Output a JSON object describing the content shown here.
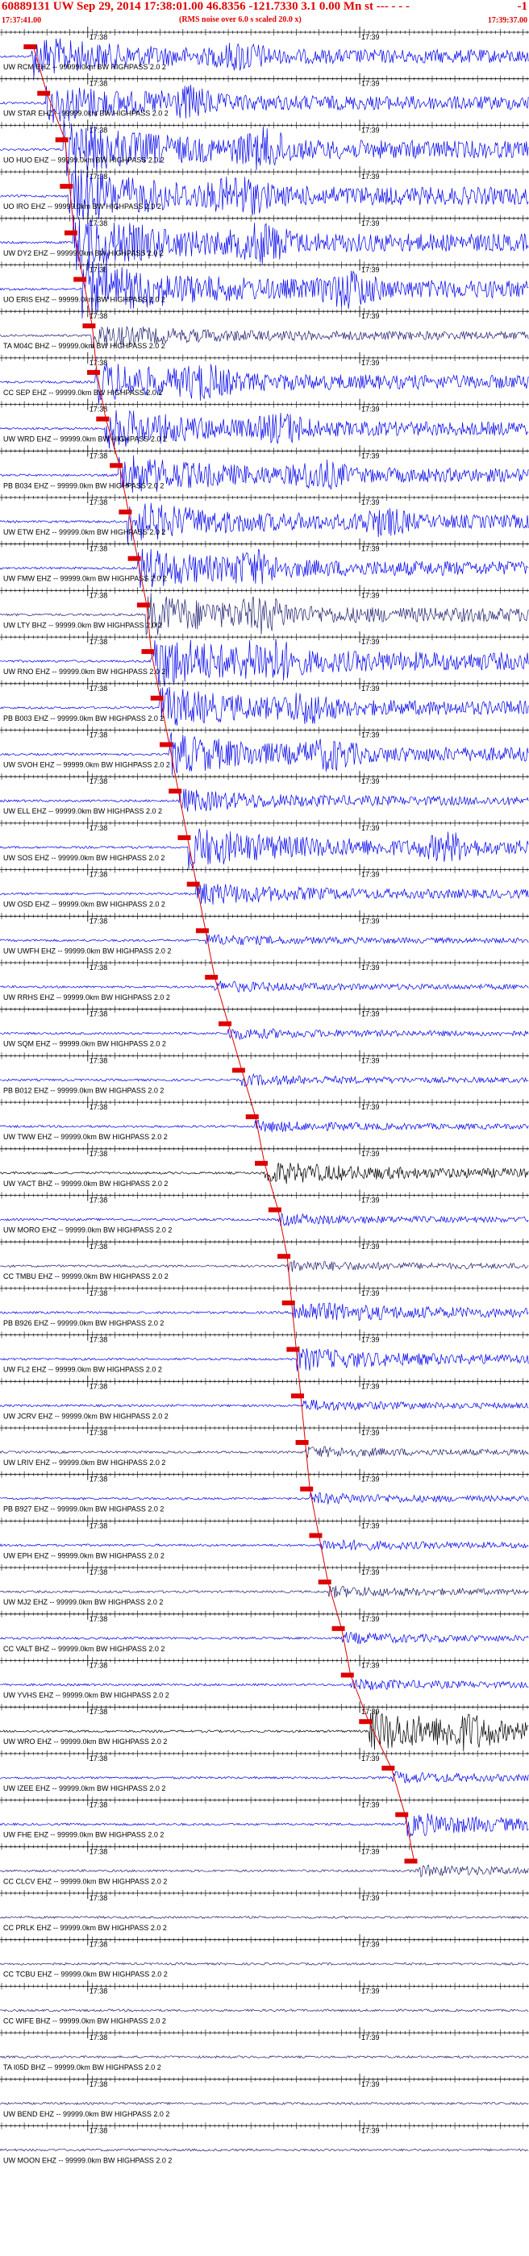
{
  "header": {
    "title": "60889131 UW Sep 29, 2014 17:38:01.00    46.8356 -121.7330  3.1 0.00 Mn st --- - - -",
    "corner": "-1",
    "subtitle": "(RMS noise over 6.0 s scaled 20.0 x)",
    "start_time": "17:37:41.00",
    "end_time": "17:39:37.00"
  },
  "colors": {
    "header_red": "#e00000",
    "blue": "#0000ee",
    "dark_blue": "#202070",
    "black": "#000000",
    "pick_red": "#dd0000",
    "axis": "#000000"
  },
  "chart_data": {
    "type": "line",
    "title": "60889131 UW Sep 29, 2014 17:38:01.00    46.8356 -121.7330  3.1 0.00 Mn st --- - - -",
    "time_window": {
      "start": "17:37:41.00",
      "end": "17:39:37.00",
      "duration_s": 116
    },
    "ticks": {
      "minor_s": 1,
      "major_s": 5,
      "labels": [
        {
          "t_s": 19,
          "label": "17:38"
        },
        {
          "t_s": 79,
          "label": "17:39"
        }
      ]
    },
    "grid": false,
    "series": [
      {
        "name": "UW RCM EHZ -- 99999.0km BW  HIGHPASS  2.0  2",
        "pick_s": 7,
        "amp": "high",
        "color": "blue"
      },
      {
        "name": "UW STAR EHZ -- 99999.0km BW  HIGHPASS  2.0  2",
        "pick_s": 10,
        "amp": "high",
        "color": "blue"
      },
      {
        "name": "UO HUO EHZ -- 99999.0km BW  HIGHPASS  2.0  2",
        "pick_s": 14,
        "amp": "saturated",
        "color": "blue"
      },
      {
        "name": "UO IRO EHZ -- 99999.0km BW  HIGHPASS  2.0  2",
        "pick_s": 15,
        "amp": "saturated",
        "color": "blue"
      },
      {
        "name": "UW DY2 EHZ -- 99999.0km BW  HIGHPASS  2.0  2",
        "pick_s": 16,
        "amp": "saturated",
        "color": "blue"
      },
      {
        "name": "UO ERIS EHZ -- 99999.0km BW  HIGHPASS  2.0  2",
        "pick_s": 18,
        "amp": "saturated",
        "color": "blue"
      },
      {
        "name": "TA M04C BHZ -- 99999.0km BW  HIGHPASS  2.0  2",
        "pick_s": 20,
        "amp": "medium",
        "color": "dark_blue"
      },
      {
        "name": "CC SEP EHZ -- 99999.0km BW  HIGHPASS  2.0  2",
        "pick_s": 21,
        "amp": "high",
        "color": "blue"
      },
      {
        "name": "UW WRD EHZ -- 99999.0km BW  HIGHPASS  2.0  2",
        "pick_s": 23,
        "amp": "high",
        "color": "blue"
      },
      {
        "name": "PB B034 EHZ -- 99999.0km BW  HIGHPASS  2.0  2",
        "pick_s": 26,
        "amp": "high",
        "color": "blue"
      },
      {
        "name": "UW ETW EHZ -- 99999.0km BW  HIGHPASS  2.0  2",
        "pick_s": 28,
        "amp": "high",
        "color": "blue"
      },
      {
        "name": "UW FMW EHZ -- 99999.0km BW  HIGHPASS  2.0  2",
        "pick_s": 30,
        "amp": "high",
        "color": "blue"
      },
      {
        "name": "UW LTY BHZ -- 99999.0km BW  HIGHPASS  2.0  2",
        "pick_s": 32,
        "amp": "high",
        "color": "dark_blue"
      },
      {
        "name": "UW RNO EHZ -- 99999.0km BW  HIGHPASS  2.0  2",
        "pick_s": 33,
        "amp": "saturated",
        "color": "blue"
      },
      {
        "name": "PB B003 EHZ -- 99999.0km BW  HIGHPASS  2.0  2",
        "pick_s": 35,
        "amp": "high",
        "color": "blue"
      },
      {
        "name": "UW SVOH EHZ -- 99999.0km BW  HIGHPASS  2.0  2",
        "pick_s": 37,
        "amp": "high",
        "color": "blue"
      },
      {
        "name": "UW ELL EHZ -- 99999.0km BW  HIGHPASS  2.0  2",
        "pick_s": 39,
        "amp": "medium",
        "color": "blue"
      },
      {
        "name": "UW SOS EHZ -- 99999.0km BW  HIGHPASS  2.0  2",
        "pick_s": 41,
        "amp": "high",
        "color": "blue"
      },
      {
        "name": "UW OSD EHZ -- 99999.0km BW  HIGHPASS  2.0  2",
        "pick_s": 43,
        "amp": "medium",
        "color": "blue"
      },
      {
        "name": "UW UWFH EHZ -- 99999.0km BW  HIGHPASS  2.0  2",
        "pick_s": 45,
        "amp": "low",
        "color": "blue"
      },
      {
        "name": "UW RRHS EHZ -- 99999.0km BW  HIGHPASS  2.0  2",
        "pick_s": 47,
        "amp": "low",
        "color": "blue"
      },
      {
        "name": "UW SQM EHZ -- 99999.0km BW  HIGHPASS  2.0  2",
        "pick_s": 50,
        "amp": "low",
        "color": "blue"
      },
      {
        "name": "PB B012 EHZ -- 99999.0km BW  HIGHPASS  2.0  2",
        "pick_s": 53,
        "amp": "low",
        "color": "blue"
      },
      {
        "name": "UW TWW EHZ -- 99999.0km BW  HIGHPASS  2.0  2",
        "pick_s": 56,
        "amp": "low",
        "color": "blue"
      },
      {
        "name": "UW YACT BHZ -- 99999.0km BW  HIGHPASS  2.0  2",
        "pick_s": 58,
        "amp": "medium",
        "color": "black"
      },
      {
        "name": "UW MORO EHZ -- 99999.0km BW  HIGHPASS  2.0  2",
        "pick_s": 61,
        "amp": "low",
        "color": "blue"
      },
      {
        "name": "CC TMBU EHZ -- 99999.0km BW  HIGHPASS  2.0  2",
        "pick_s": 63,
        "amp": "low",
        "color": "dark_blue"
      },
      {
        "name": "PB B926 EHZ -- 99999.0km BW  HIGHPASS  2.0  2",
        "pick_s": 64,
        "amp": "medium",
        "color": "blue"
      },
      {
        "name": "UW FL2 EHZ -- 99999.0km BW  HIGHPASS  2.0  2",
        "pick_s": 65,
        "amp": "medium",
        "color": "blue"
      },
      {
        "name": "UW JCRV EHZ -- 99999.0km BW  HIGHPASS  2.0  2",
        "pick_s": 66,
        "amp": "low",
        "color": "blue"
      },
      {
        "name": "UW LRIV EHZ -- 99999.0km BW  HIGHPASS  2.0  2",
        "pick_s": 67,
        "amp": "low",
        "color": "dark_blue"
      },
      {
        "name": "PB B927 EHZ -- 99999.0km BW  HIGHPASS  2.0  2",
        "pick_s": 68,
        "amp": "low",
        "color": "blue"
      },
      {
        "name": "UW EPH EHZ -- 99999.0km BW  HIGHPASS  2.0  2",
        "pick_s": 70,
        "amp": "low",
        "color": "blue"
      },
      {
        "name": "UW MJ2 EHZ -- 99999.0km BW  HIGHPASS  2.0  2",
        "pick_s": 72,
        "amp": "low",
        "color": "dark_blue"
      },
      {
        "name": "CC VALT BHZ -- 99999.0km BW  HIGHPASS  2.0  2",
        "pick_s": 75,
        "amp": "low",
        "color": "blue"
      },
      {
        "name": "UW YVHS EHZ -- 99999.0km BW  HIGHPASS  2.0  2",
        "pick_s": 77,
        "amp": "low",
        "color": "blue"
      },
      {
        "name": "UW WRO EHZ -- 99999.0km BW  HIGHPASS  2.0  2",
        "pick_s": 81,
        "amp": "high",
        "color": "black"
      },
      {
        "name": "UW IZEE EHZ -- 99999.0km BW  HIGHPASS  2.0  2",
        "pick_s": 86,
        "amp": "low",
        "color": "blue"
      },
      {
        "name": "UW FHE EHZ -- 99999.0km BW  HIGHPASS  2.0  2",
        "pick_s": 89,
        "amp": "medium",
        "color": "blue"
      },
      {
        "name": "CC CLCV EHZ -- 99999.0km BW  HIGHPASS  2.0  2",
        "pick_s": 91,
        "amp": "low",
        "color": "dark_blue"
      },
      {
        "name": "CC PRLK EHZ -- 99999.0km BW  HIGHPASS  2.0  2",
        "pick_s": null,
        "amp": "low",
        "color": "dark_blue"
      },
      {
        "name": "CC TCBU EHZ -- 99999.0km BW  HIGHPASS  2.0  2",
        "pick_s": null,
        "amp": "low",
        "color": "dark_blue"
      },
      {
        "name": "CC WIFE BHZ -- 99999.0km BW  HIGHPASS  2.0  2",
        "pick_s": null,
        "amp": "low",
        "color": "dark_blue"
      },
      {
        "name": "TA I05D BHZ -- 99999.0km BW  HIGHPASS  2.0  2",
        "pick_s": null,
        "amp": "low",
        "color": "dark_blue"
      },
      {
        "name": "UW BEND EHZ -- 99999.0km BW  HIGHPASS  2.0  2",
        "pick_s": null,
        "amp": "low",
        "color": "dark_blue"
      },
      {
        "name": "UW MOON EHZ -- 99999.0km BW  HIGHPASS  2.0  2",
        "pick_s": null,
        "amp": "low",
        "color": "dark_blue"
      }
    ]
  }
}
